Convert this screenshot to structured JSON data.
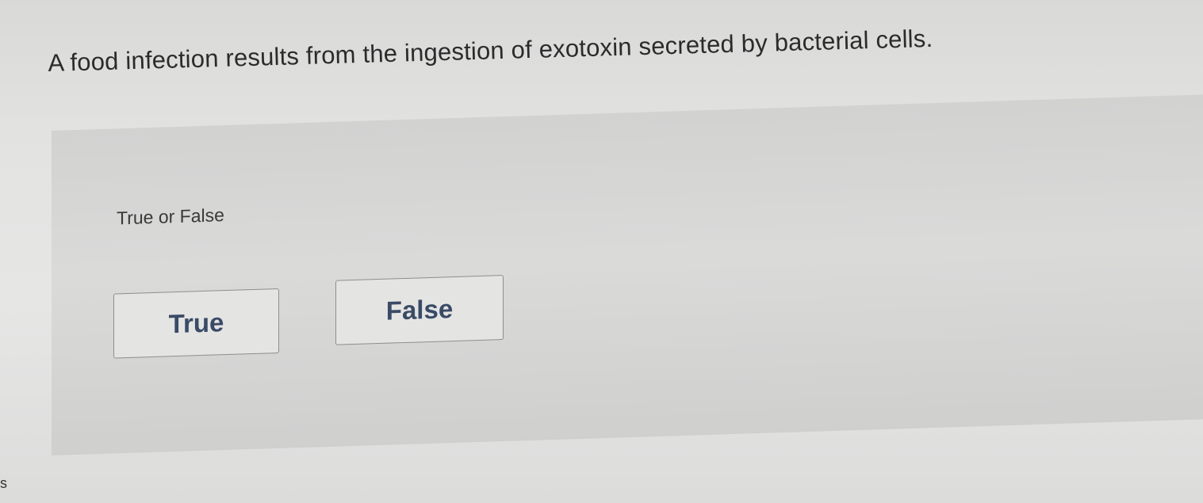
{
  "question": {
    "text": "A food infection results from the ingestion of exotoxin secreted by bacterial cells."
  },
  "answer_panel": {
    "prompt": "True or False",
    "choices": [
      {
        "label": "True"
      },
      {
        "label": "False"
      }
    ]
  },
  "edge_mark": "s"
}
